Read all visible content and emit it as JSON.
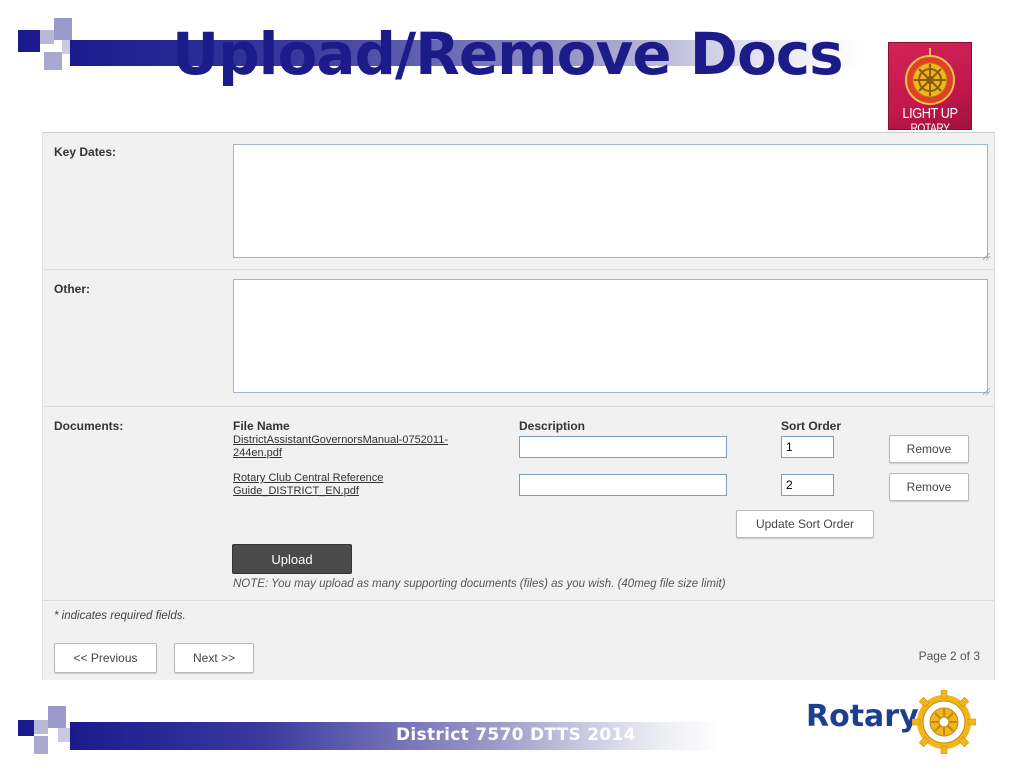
{
  "slide": {
    "title": "Upload/Remove Docs",
    "logo_text_line1": "LIGHT UP",
    "logo_text_line2": "ROTARY",
    "footer_text": "District 7570 DTTS 2014",
    "rotary_word": "Rotary",
    "colors": {
      "title": "#1b1b8a",
      "bar": "#1a1a8c",
      "logo_bg": "#c2184c",
      "rotary_blue": "#1e3f8f",
      "rotary_gold": "#f3b51c"
    }
  },
  "form": {
    "key_dates": {
      "label": "Key Dates:",
      "value": ""
    },
    "other": {
      "label": "Other:",
      "value": ""
    },
    "documents": {
      "label": "Documents:",
      "columns": {
        "file_name": "File Name",
        "description": "Description",
        "sort_order": "Sort Order"
      },
      "files": [
        {
          "name_line1": "DistrictAssistantGovernorsManual-0752011-",
          "name_line2": "244en.pdf",
          "description": "",
          "sort_order": "1",
          "remove_label": "Remove"
        },
        {
          "name_line1": "Rotary Club Central Reference",
          "name_line2": "Guide_DISTRICT_EN.pdf",
          "description": "",
          "sort_order": "2",
          "remove_label": "Remove"
        }
      ],
      "update_sort_label": "Update Sort Order",
      "upload_label": "Upload",
      "note": "NOTE: You may upload as many supporting documents (files) as you wish.  (40meg file size limit)"
    },
    "required_note": "* indicates required fields.",
    "nav": {
      "previous_label": "<< Previous",
      "next_label": "Next >>"
    },
    "page_indicator": "Page 2 of 3"
  }
}
